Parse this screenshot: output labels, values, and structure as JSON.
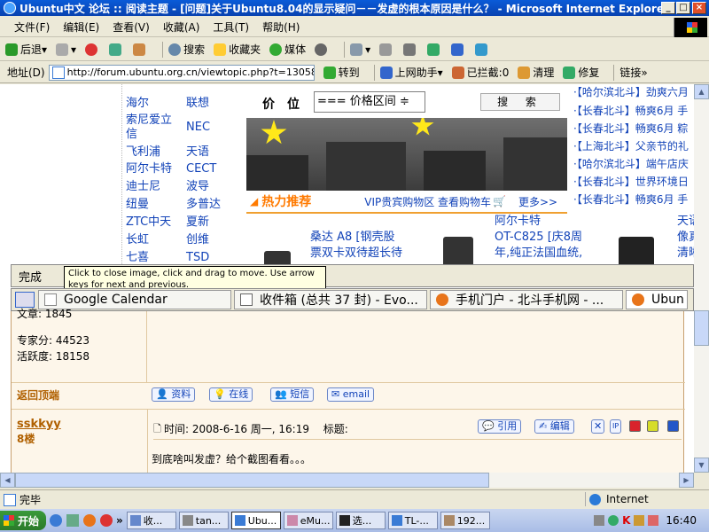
{
  "window": {
    "title": "Ubuntu中文 论坛 :: 阅读主题 - [问题]关于Ubuntu8.04的显示疑问－－发虚的根本原因是什么？ - Microsoft Internet Explorer"
  },
  "menu": [
    "文件(F)",
    "编辑(E)",
    "查看(V)",
    "收藏(A)",
    "工具(T)",
    "帮助(H)"
  ],
  "toolbar": {
    "back": "后退",
    "search": "搜索",
    "favorites": "收藏夹",
    "media": "媒体"
  },
  "address": {
    "label": "地址(D)",
    "url": "http://forum.ubuntu.org.cn/viewtopic.php?t=130587&",
    "go": "转到",
    "assistant": "上网助手",
    "blocked": "已拦截:0",
    "clean": "清理",
    "repair": "修复",
    "links": "链接"
  },
  "page": {
    "brands": [
      "海尔",
      "联想",
      "索尼爱立信",
      "NEC",
      "飞利浦",
      "天语",
      "阿尔卡特",
      "CECT",
      "迪士尼",
      "波导",
      "纽曼",
      "多普达",
      "ZTC中天",
      "夏新",
      "长虹",
      "创维",
      "七喜",
      "TSD"
    ],
    "price_label": "价　位",
    "price_select": "=== 价格区间 ≑",
    "search_button": "搜 索",
    "hot_title": "热力推荐",
    "vip": "VIP贵宾购物区 查看购物车",
    "more": "更多>>",
    "news": [
      "·【哈尔滨北斗】劲爽六月",
      "·【长春北斗】畅爽6月 手",
      "·【长春北斗】畅爽6月 粽",
      "·【上海北斗】父亲节的礼",
      "·【哈尔滨北斗】端午店庆",
      "·【长春北斗】世界环境日",
      "·【长春北斗】畅爽6月 手"
    ],
    "products": [
      "桑达 A8 [钢壳股",
      "票双卡双待超长待",
      "阿尔卡特",
      "OT-C825 [庆8周",
      "年,纯正法国血统,",
      "天语",
      "像真",
      "清晰"
    ]
  },
  "overlay": {
    "status": "完成",
    "tooltip": "Click to close image, click and drag to move. Use arrow keys for next and previous.",
    "tabs": [
      "Google Calendar",
      "收件箱 (总共 37 封) - Evo...",
      "手机门户 - 北斗手机网 - ...",
      "Ubun"
    ]
  },
  "forum": {
    "posts_label": "文章: 1845",
    "expert": "专家分: 44523",
    "activity": "活跃度: 18158",
    "back_top": "返回顶端",
    "buttons": [
      "资料",
      "在线",
      "短信",
      "email"
    ],
    "poster": "sskkyy",
    "floor": "8楼",
    "time": "时间: 2008-6-16 周一, 16:19　 标题:",
    "actions": [
      "引用",
      "编辑"
    ],
    "body": "到底啥叫发虚？给个截图看看。。。"
  },
  "statusbar": {
    "text": "完毕",
    "zone": "Internet"
  },
  "taskbar": {
    "start": "开始",
    "tasks": [
      "收...",
      "tan...",
      "Ubu...",
      "eMu...",
      "选...",
      "TL-...",
      "192..."
    ],
    "clock": "16:40"
  }
}
